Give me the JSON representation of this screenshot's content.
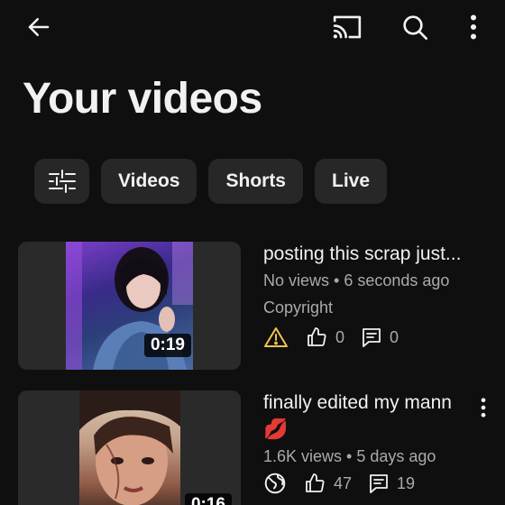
{
  "header": {
    "back_icon": "arrow-left-icon",
    "cast_icon": "cast-icon",
    "search_icon": "search-icon",
    "more_icon": "more-vert-icon"
  },
  "page_title": "Your videos",
  "chips": [
    {
      "icon": "filter-sliders-icon"
    },
    {
      "label": "Videos"
    },
    {
      "label": "Shorts"
    },
    {
      "label": "Live"
    }
  ],
  "videos": [
    {
      "title": "posting this scrap just...",
      "views": "No views",
      "time": "6 seconds ago",
      "restriction": "Copyright",
      "duration": "0:19",
      "status_icon": "warning-icon",
      "likes": "0",
      "comments": "0"
    },
    {
      "title": "finally edited my mann",
      "emoji": "💋",
      "views": "1.6K views",
      "time": "5 days ago",
      "duration": "0:16",
      "status_icon": "globe-public-icon",
      "likes": "47",
      "comments": "19"
    }
  ],
  "colors": {
    "background": "#0f0f0f",
    "chip_bg": "#272727",
    "text_primary": "#f1f1f1",
    "text_secondary": "#aaaaaa",
    "warning": "#f2c14e"
  }
}
